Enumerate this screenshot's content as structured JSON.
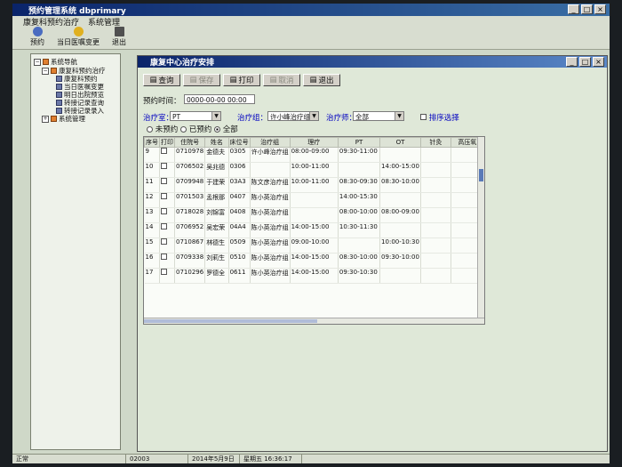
{
  "window": {
    "title": "预约管理系统  dbprimary"
  },
  "menu": [
    "康复科预约治疗",
    "系统管理"
  ],
  "toolbar": [
    {
      "label": "预约",
      "icon": "appointment-icon",
      "color": "#4a6cc0"
    },
    {
      "label": "当日医嘱变更",
      "icon": "order-change-icon",
      "color": "#e0b020"
    },
    {
      "label": "退出",
      "icon": "exit-icon",
      "color": "#505050"
    }
  ],
  "sidebar": {
    "root": "系统导航",
    "group1": "康复科预约治疗",
    "items": [
      "康复科预约",
      "当日医嘱变更",
      "明日出院预览",
      "转接记录查询",
      "转接记录录入"
    ],
    "group2": "系统管理"
  },
  "child": {
    "title": "康复中心治疗安排",
    "buttons": {
      "query": "查询",
      "save": "保存",
      "print": "打印",
      "cancel": "取消",
      "exit": "退出"
    },
    "time_label": "预约时间：",
    "time_value": "0000-00-00 00:00",
    "ward_label": "治疗室：",
    "ward_value": "PT",
    "group_label": "治疗组：",
    "group_value": "许小峰治疗组",
    "order_label": "治疗师：",
    "order_value": "全部",
    "sort_label": "排序选择",
    "radios": [
      "未预约",
      "已预约",
      "全部"
    ]
  },
  "table": {
    "headers": [
      "序号",
      "打印",
      "住院号",
      "姓名",
      "床位号",
      "治疗组",
      "理疗",
      "PT",
      "OT",
      "针灸",
      "高压氧"
    ],
    "rows": [
      {
        "no": "9",
        "id": "0710978",
        "name": "金德夫",
        "bed": "0305",
        "group": "许小峰治疗组",
        "li": "08:00-09:00",
        "pt": "09:30-11:00",
        "ot": ""
      },
      {
        "no": "10",
        "id": "0706502",
        "name": "吴兆德",
        "bed": "0306",
        "group": "",
        "li": "10:00-11:00",
        "pt": "",
        "ot": "14:00-15:00"
      },
      {
        "no": "11",
        "id": "0709948",
        "name": "于建荣",
        "bed": "03A3",
        "group": "陈文彦治疗组",
        "li": "10:00-11:00",
        "pt": "08:30-09:30",
        "ot": "08:30-10:00"
      },
      {
        "no": "12",
        "id": "0701503",
        "name": "孟根那",
        "bed": "0407",
        "group": "陈小英治疗组",
        "li": "",
        "pt": "14:00-15:30",
        "ot": ""
      },
      {
        "no": "13",
        "id": "0718028",
        "name": "刘锦富",
        "bed": "0408",
        "group": "陈小英治疗组",
        "li": "",
        "pt": "08:00-10:00",
        "ot": "08:00-09:00"
      },
      {
        "no": "14",
        "id": "0706952",
        "name": "吴宏荣",
        "bed": "04A4",
        "group": "陈小英治疗组",
        "li": "14:00-15:00",
        "pt": "10:30-11:30",
        "ot": ""
      },
      {
        "no": "15",
        "id": "0710867",
        "name": "林德生",
        "bed": "0509",
        "group": "陈小英治疗组",
        "li": "09:00-10:00",
        "pt": "",
        "ot": "10:00-10:30"
      },
      {
        "no": "16",
        "id": "0709338",
        "name": "刘莉生",
        "bed": "0510",
        "group": "陈小英治疗组",
        "li": "14:00-15:00",
        "pt": "08:30-10:00",
        "ot": "09:30-10:00"
      },
      {
        "no": "17",
        "id": "0710296",
        "name": "罗德全",
        "bed": "0611",
        "group": "陈小英治疗组",
        "li": "14:00-15:00",
        "pt": "09:30-10:30",
        "ot": ""
      }
    ]
  },
  "status": {
    "state": "正常",
    "code": "02003",
    "date": "2014年5月9日",
    "time": "星期五 16:36:17"
  }
}
